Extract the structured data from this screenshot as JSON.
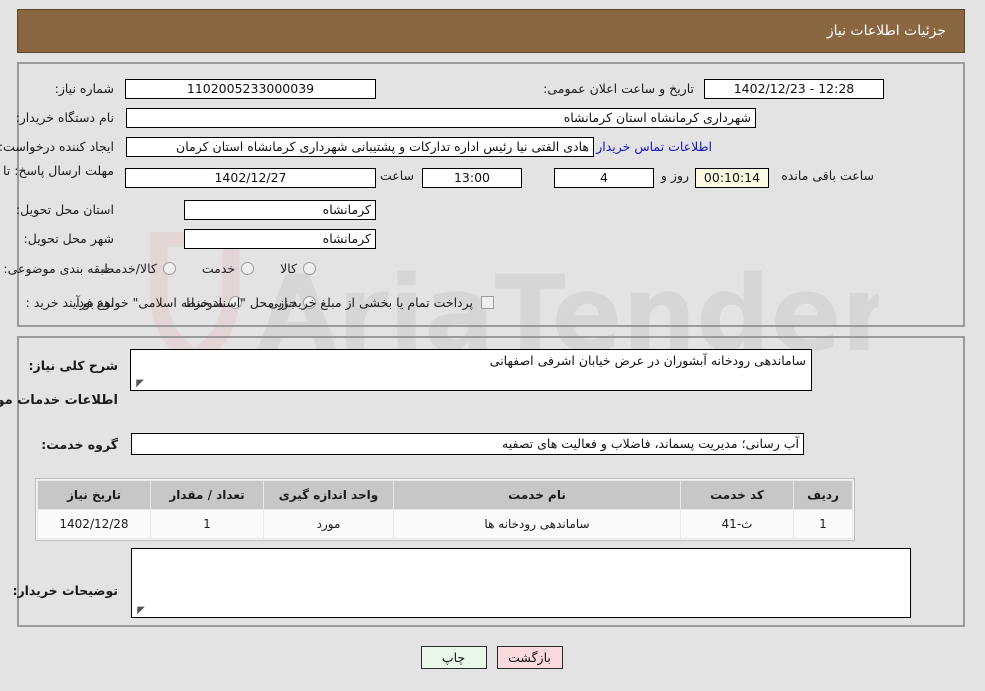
{
  "header": {
    "title": "جزئیات اطلاعات نیاز"
  },
  "fields": {
    "need_number_label": "شماره نیاز:",
    "need_number_value": "1102005233000039",
    "announce_label": "تاریخ و ساعت اعلان عمومی:",
    "announce_value": "12:28 - 1402/12/23",
    "buyer_org_label": "نام دستگاه خریدار:",
    "buyer_org_value": "شهرداری کرمانشاه استان کرمانشاه",
    "creator_label": "ایجاد کننده درخواست:",
    "creator_value": "هادی الفتی نیا رئیس اداره تدارکات و پشتیبانی شهرداری کرمانشاه استان کرمان",
    "buyer_contact_link": "اطلاعات تماس خریدار",
    "deadline_label": "مهلت ارسال پاسخ: تا تاریخ:",
    "deadline_date": "1402/12/27",
    "hour_label": "ساعت",
    "deadline_time": "13:00",
    "days_value": "4",
    "days_label": "روز و",
    "countdown_value": "00:10:14",
    "countdown_label": "ساعت باقی مانده",
    "province_label": "استان محل تحویل:",
    "province_value": "کرمانشاه",
    "city_label": "شهر محل تحویل:",
    "city_value": "کرمانشاه",
    "category_label": "طبقه بندی موضوعی:",
    "process_label": "نوع فرآیند خرید :",
    "treasury_note": "پرداخت تمام یا بخشی از مبلغ خرید،از محل \"اسناد خزانه اسلامی\" خواهد بود.",
    "summary_label": "شرح کلی نیاز:",
    "summary_value": "ساماندهی رودخانه آبشوران در عرض خیابان اشرفی اصفهانی",
    "services_section_title": "اطلاعات خدمات مورد نیاز",
    "service_group_label": "گروه خدمت:",
    "service_group_value": "آب رسانی؛ مدیریت پسماند، فاضلاب و فعالیت های تصفیه",
    "buyer_notes_label": "توضیحات خریدار:",
    "buyer_notes_value": ""
  },
  "category_options": [
    {
      "label": "کالا",
      "selected": false
    },
    {
      "label": "خدمت",
      "selected": false
    },
    {
      "label": "کالا/خدمت",
      "selected": false
    }
  ],
  "process_options": [
    {
      "label": "جزیی",
      "selected": false
    },
    {
      "label": "متوسط",
      "selected": false
    }
  ],
  "treasury_checkbox": {
    "checked": false
  },
  "table": {
    "headers": [
      "ردیف",
      "کد خدمت",
      "نام خدمت",
      "واحد اندازه گیری",
      "تعداد / مقدار",
      "تاریخ نیاز"
    ],
    "rows": [
      [
        "1",
        "ث-41",
        "ساماندهی رودخانه ها",
        "مورد",
        "1",
        "1402/12/28"
      ]
    ]
  },
  "buttons": {
    "print": "چاپ",
    "back": "بازگشت"
  },
  "watermark": {
    "text": "AriaTender.net"
  },
  "colors": {
    "header_bg": "#8a6641",
    "link": "#1414c8",
    "countdown_bg": "#fbfbe4",
    "back_btn_bg": "#fadadd",
    "print_btn_bg": "#e9f7e9",
    "page_bg": "#e3e3e3"
  }
}
